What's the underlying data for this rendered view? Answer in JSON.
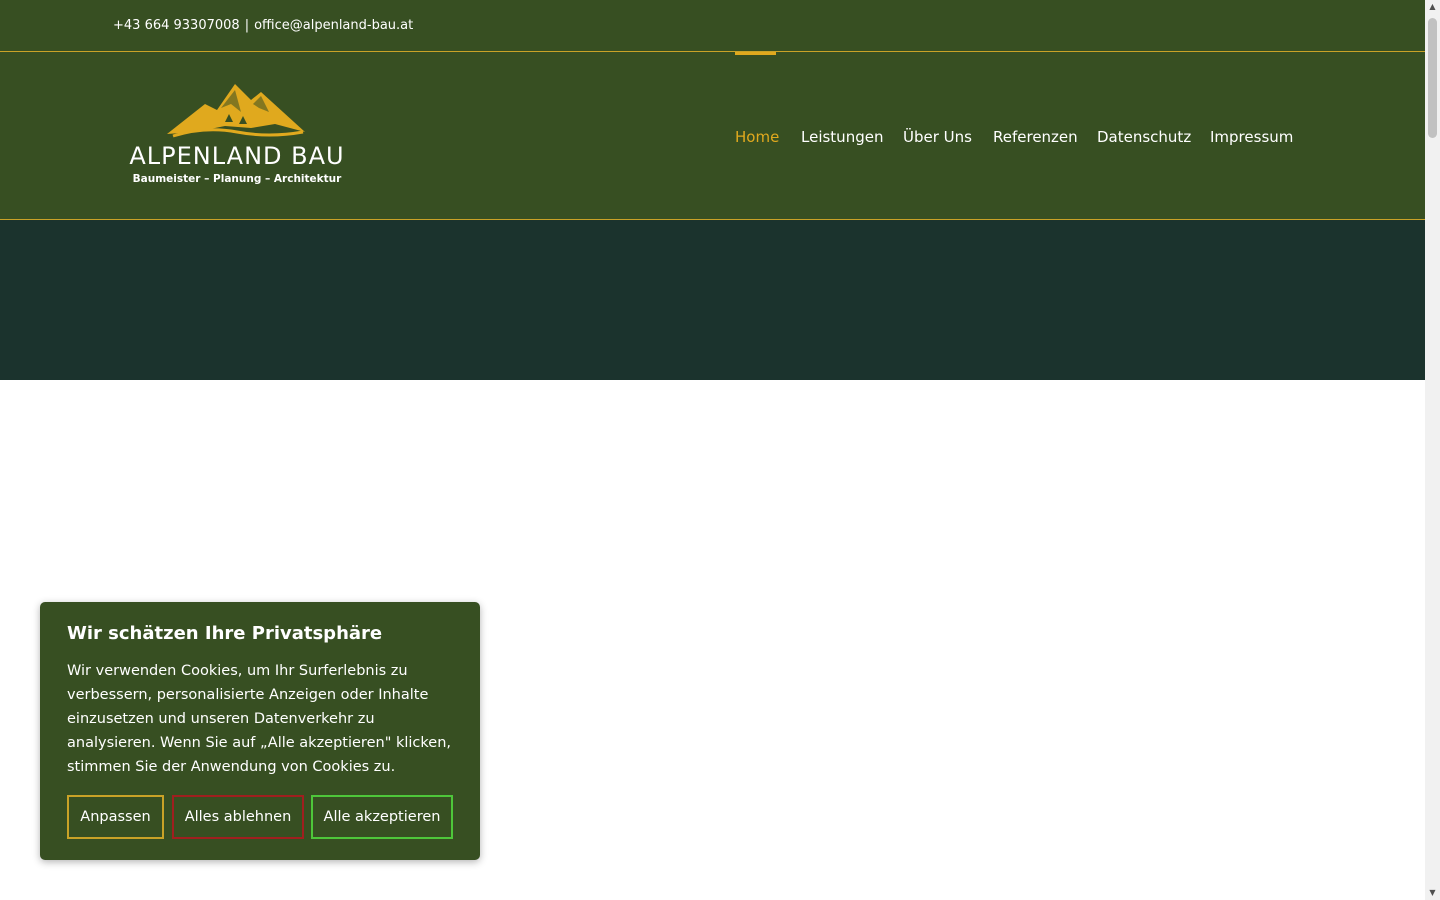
{
  "topbar": {
    "phone": "+43 664 93307008",
    "separator": "|",
    "email": "office@alpenland-bau.at"
  },
  "logo": {
    "brand": "ALPENLAND BAU",
    "tagline": "Baumeister – Planung – Architektur"
  },
  "nav": {
    "items": [
      {
        "label": "Home",
        "active": true
      },
      {
        "label": "Leistungen",
        "active": false
      },
      {
        "label": "Über Uns",
        "active": false
      },
      {
        "label": "Referenzen",
        "active": false
      },
      {
        "label": "Datenschutz",
        "active": false
      },
      {
        "label": "Impressum",
        "active": false
      }
    ]
  },
  "cookie": {
    "title": "Wir schätzen Ihre Privatsphäre",
    "text": "Wir verwenden Cookies, um Ihr Surferlebnis zu verbessern, personalisierte Anzeigen oder Inhalte einzusetzen und unseren Datenverkehr zu analysieren. Wenn Sie auf „Alle akzeptieren\" klicken, stimmen Sie der Anwendung von Cookies zu.",
    "customize_label": "Anpassen",
    "reject_label": "Alles ablehnen",
    "accept_label": "Alle akzeptieren"
  },
  "colors": {
    "header_green": "#374f22",
    "hero_dark": "#1b332d",
    "accent_gold": "#e0a91e",
    "reject_red": "#a01f1f",
    "accept_green": "#4ec63a"
  },
  "icons": {
    "logo_mark": "mountain-icon",
    "scroll_up": "chevron-up-icon",
    "scroll_down": "chevron-down-icon"
  }
}
